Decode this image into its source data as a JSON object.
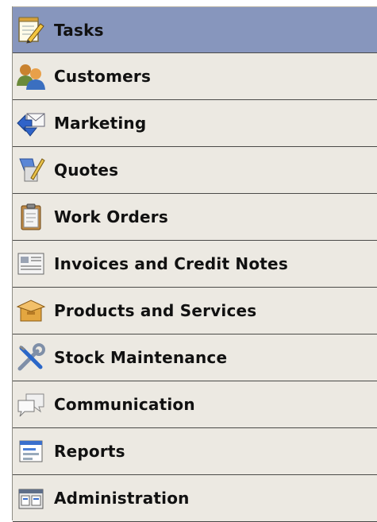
{
  "nav": {
    "items": [
      {
        "label": "Tasks",
        "icon": "notepad-pencil-icon",
        "active": true
      },
      {
        "label": "Customers",
        "icon": "people-icon"
      },
      {
        "label": "Marketing",
        "icon": "mail-arrows-icon"
      },
      {
        "label": "Quotes",
        "icon": "clipboard-pencil-icon"
      },
      {
        "label": "Work Orders",
        "icon": "clipboard-icon"
      },
      {
        "label": "Invoices and Credit Notes",
        "icon": "invoice-icon"
      },
      {
        "label": "Products and Services",
        "icon": "box-icon"
      },
      {
        "label": "Stock Maintenance",
        "icon": "wrench-screwdriver-icon"
      },
      {
        "label": "Communication",
        "icon": "speech-bubbles-icon"
      },
      {
        "label": "Reports",
        "icon": "report-window-icon"
      },
      {
        "label": "Administration",
        "icon": "admin-window-icon"
      }
    ]
  },
  "colors": {
    "active_bg": "#8796bd",
    "item_bg": "#ece9e2",
    "divider": "#4a4a48"
  }
}
